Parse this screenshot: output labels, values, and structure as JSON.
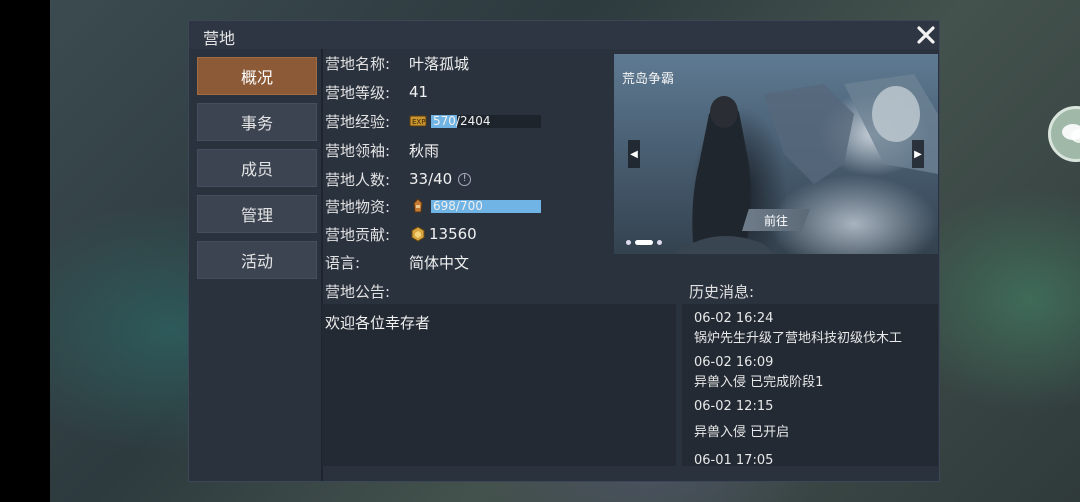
{
  "dialog": {
    "title": "营地"
  },
  "sidebar": {
    "items": [
      {
        "label": "概况",
        "active": true
      },
      {
        "label": "事务"
      },
      {
        "label": "成员"
      },
      {
        "label": "管理"
      },
      {
        "label": "活动"
      }
    ]
  },
  "info": {
    "name_label": "营地名称:",
    "name_value": "叶落孤城",
    "level_label": "营地等级:",
    "level_value": "41",
    "exp_label": "营地经验:",
    "exp_current": "570",
    "exp_text": "570/2404",
    "exp_fraction": 0.237,
    "leader_label": "营地领袖:",
    "leader_value": "秋雨",
    "members_label": "营地人数:",
    "members_value": "33/40",
    "supplies_label": "营地物资:",
    "supplies_text": "698/700",
    "supplies_fraction": 0.997,
    "contribution_label": "营地贡献:",
    "contribution_value": "13560",
    "language_label": "语言:",
    "language_value": "简体中文"
  },
  "banner": {
    "title": "荒岛争霸",
    "go_label": "前往"
  },
  "announcement": {
    "label": "营地公告:",
    "text": "欢迎各位幸存者"
  },
  "history": {
    "label": "历史消息:",
    "entries": [
      {
        "time": "06-02 16:24",
        "text": "锅炉先生升级了营地科技初级伐木工"
      },
      {
        "time": "06-02 16:09",
        "text": "异兽入侵 已完成阶段1"
      },
      {
        "time": "06-02 12:15",
        "text": "异兽入侵 已开启"
      },
      {
        "time": "06-01 17:05",
        "text": ""
      }
    ]
  },
  "colors": {
    "accent_tab": "#8c5a36",
    "supplies_bar": "#6fb4e4",
    "exp_bar": "#6fb4e4"
  }
}
